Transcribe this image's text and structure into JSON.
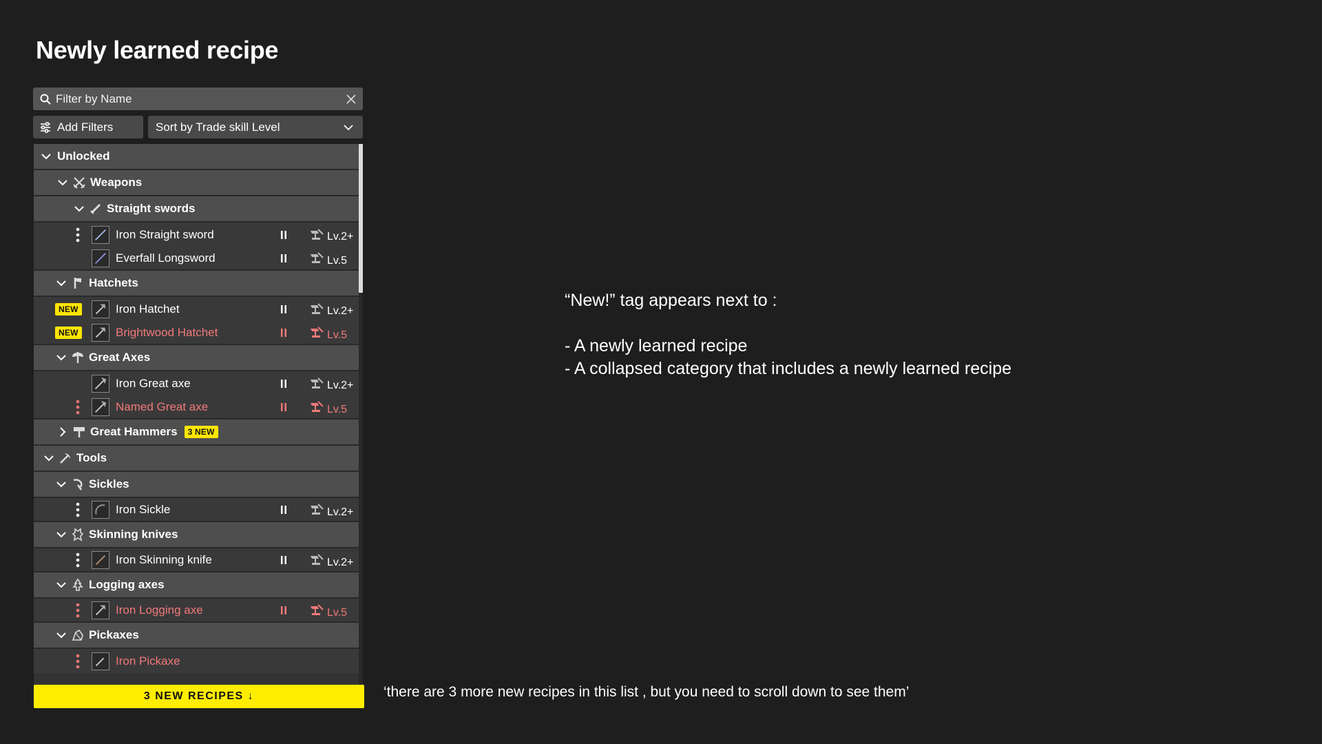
{
  "page_title": "Newly learned recipe",
  "search": {
    "placeholder": "Filter by Name"
  },
  "toolbar": {
    "add_filters_label": "Add Filters",
    "sort_label": "Sort by Trade skill Level"
  },
  "colors": {
    "accent_yellow": "#ffed00",
    "new_recipe_red": "#f07a78",
    "background": "#1f1e1f"
  },
  "list": {
    "unlocked_label": "Unlocked",
    "weapons_label": "Weapons",
    "straight_swords_label": "Straight swords",
    "iron_straight_sword": {
      "name": "Iron Straight sword",
      "level": "Lv.2+"
    },
    "everfall_longsword": {
      "name": "Everfall Longsword",
      "level": "Lv.5"
    },
    "hatchets_label": "Hatchets",
    "iron_hatchet": {
      "name": "Iron Hatchet",
      "level": "Lv.2+",
      "badge": "NEW"
    },
    "brightwood_hatchet": {
      "name": "Brightwood Hatchet",
      "level": "Lv.5",
      "badge": "NEW"
    },
    "great_axes_label": "Great Axes",
    "iron_great_axe": {
      "name": "Iron Great axe",
      "level": "Lv.2+"
    },
    "named_great_axe": {
      "name": "Named Great axe",
      "level": "Lv.5"
    },
    "great_hammers_label": "Great Hammers",
    "great_hammers_badge": "3 NEW",
    "tools_label": "Tools",
    "sickles_label": "Sickles",
    "iron_sickle": {
      "name": "Iron Sickle",
      "level": "Lv.2+"
    },
    "skinning_knives_label": "Skinning knives",
    "iron_skinning_knife": {
      "name": "Iron Skinning knife",
      "level": "Lv.2+"
    },
    "logging_axes_label": "Logging axes",
    "iron_logging_axe": {
      "name": "Iron Logging axe",
      "level": "Lv.5"
    },
    "pickaxes_label": "Pickaxes",
    "iron_pickaxe": {
      "name": "Iron Pickaxe"
    }
  },
  "cta_label": "3 NEW RECIPES ↓",
  "notes": {
    "line1": "“New!” tag appears next to :",
    "line2": "- A newly learned recipe",
    "line3": "- A collapsed category that includes a newly learned recipe"
  },
  "footnote": "‘there are 3 more new recipes in this list , but you need to scroll down to see them’"
}
